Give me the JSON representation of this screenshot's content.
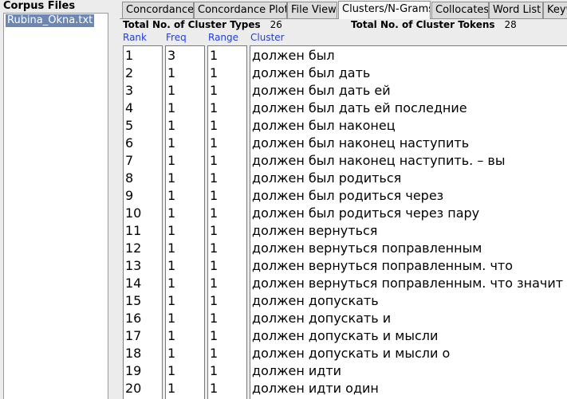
{
  "sidebar": {
    "title": "Corpus Files",
    "files": [
      "Rubina_Okna.txt"
    ]
  },
  "tabs": [
    {
      "label": "Concordance",
      "active": false
    },
    {
      "label": "Concordance Plot",
      "active": false
    },
    {
      "label": "File View",
      "active": false
    },
    {
      "label": "Clusters/N-Grams",
      "active": true
    },
    {
      "label": "Collocates",
      "active": false
    },
    {
      "label": "Word List",
      "active": false
    },
    {
      "label": "Keyw",
      "active": false
    }
  ],
  "stats": {
    "cluster_types_label": "Total No. of Cluster Types",
    "cluster_types_value": "26",
    "cluster_tokens_label": "Total No. of Cluster Tokens",
    "cluster_tokens_value": "28"
  },
  "columns": {
    "rank": "Rank",
    "freq": "Freq",
    "range": "Range",
    "cluster": "Cluster"
  },
  "rows": [
    {
      "rank": "1",
      "freq": "3",
      "range": "1",
      "cluster": "должен был"
    },
    {
      "rank": "2",
      "freq": "1",
      "range": "1",
      "cluster": "должен был дать"
    },
    {
      "rank": "3",
      "freq": "1",
      "range": "1",
      "cluster": "должен был дать ей"
    },
    {
      "rank": "4",
      "freq": "1",
      "range": "1",
      "cluster": "должен был дать ей последние"
    },
    {
      "rank": "5",
      "freq": "1",
      "range": "1",
      "cluster": "должен был наконец"
    },
    {
      "rank": "6",
      "freq": "1",
      "range": "1",
      "cluster": "должен был наконец наступить"
    },
    {
      "rank": "7",
      "freq": "1",
      "range": "1",
      "cluster": "должен был наконец наступить. – вы"
    },
    {
      "rank": "8",
      "freq": "1",
      "range": "1",
      "cluster": "должен был родиться"
    },
    {
      "rank": "9",
      "freq": "1",
      "range": "1",
      "cluster": "должен был родиться через"
    },
    {
      "rank": "10",
      "freq": "1",
      "range": "1",
      "cluster": "должен был родиться через пару"
    },
    {
      "rank": "11",
      "freq": "1",
      "range": "1",
      "cluster": "должен вернуться"
    },
    {
      "rank": "12",
      "freq": "1",
      "range": "1",
      "cluster": "должен вернуться поправленным"
    },
    {
      "rank": "13",
      "freq": "1",
      "range": "1",
      "cluster": "должен вернуться поправленным. что"
    },
    {
      "rank": "14",
      "freq": "1",
      "range": "1",
      "cluster": "должен вернуться поправленным. что значит"
    },
    {
      "rank": "15",
      "freq": "1",
      "range": "1",
      "cluster": "должен допускать"
    },
    {
      "rank": "16",
      "freq": "1",
      "range": "1",
      "cluster": "должен допускать и"
    },
    {
      "rank": "17",
      "freq": "1",
      "range": "1",
      "cluster": "должен допускать и мысли"
    },
    {
      "rank": "18",
      "freq": "1",
      "range": "1",
      "cluster": "должен допускать и мысли о"
    },
    {
      "rank": "19",
      "freq": "1",
      "range": "1",
      "cluster": "должен идти"
    },
    {
      "rank": "20",
      "freq": "1",
      "range": "1",
      "cluster": "должен идти один"
    }
  ]
}
